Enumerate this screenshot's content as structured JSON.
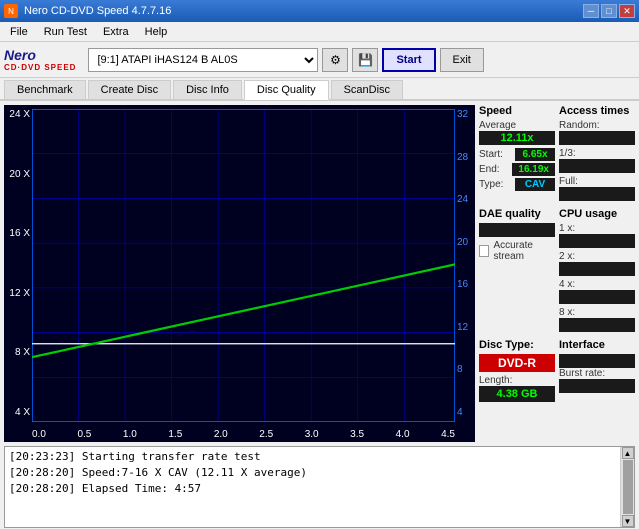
{
  "titleBar": {
    "title": "Nero CD-DVD Speed 4.7.7.16",
    "controls": [
      "minimize",
      "maximize",
      "close"
    ]
  },
  "menuBar": {
    "items": [
      "File",
      "Run Test",
      "Extra",
      "Help"
    ]
  },
  "toolbar": {
    "logoTop": "Nero",
    "logoBottom": "CD·DVD SPEED",
    "driveLabel": "[9:1]  ATAPI iHAS124  B AL0S",
    "startLabel": "Start",
    "exitLabel": "Exit"
  },
  "tabs": {
    "items": [
      "Benchmark",
      "Create Disc",
      "Disc Info",
      "Disc Quality",
      "ScanDisc"
    ],
    "active": "Disc Quality"
  },
  "chart": {
    "yLeftLabels": [
      "24 X",
      "20 X",
      "16 X",
      "12 X",
      "8 X",
      "4 X"
    ],
    "yRightLabels": [
      "32",
      "28",
      "24",
      "20",
      "16",
      "12",
      "8",
      "4"
    ],
    "xLabels": [
      "0.0",
      "0.5",
      "1.0",
      "1.5",
      "2.0",
      "2.5",
      "3.0",
      "3.5",
      "4.0",
      "4.5"
    ]
  },
  "speedPanel": {
    "title": "Speed",
    "averageLabel": "Average",
    "averageValue": "12.11x",
    "startLabel": "Start:",
    "startValue": "6.65x",
    "endLabel": "End:",
    "endValue": "16.19x",
    "typeLabel": "Type:",
    "typeValue": "CAV"
  },
  "daePanel": {
    "title": "DAE quality",
    "accurateStreamLabel": "Accurate stream"
  },
  "discPanel": {
    "title": "Disc Type:",
    "typeValue": "DVD-R",
    "lengthLabel": "Length:",
    "lengthValue": "4.38 GB"
  },
  "accessPanel": {
    "title": "Access times",
    "randomLabel": "Random:"
  },
  "cpuPanel": {
    "title": "CPU usage",
    "labels": [
      "1 x:",
      "2 x:",
      "4 x:",
      "8 x:"
    ]
  },
  "interfacePanel": {
    "title": "Interface",
    "burstLabel": "Burst rate:"
  },
  "log": {
    "lines": [
      "[20:23:23]  Starting transfer rate test",
      "[20:28:20]  Speed:7-16 X CAV (12.11 X average)",
      "[20:28:20]  Elapsed Time: 4:57"
    ]
  }
}
